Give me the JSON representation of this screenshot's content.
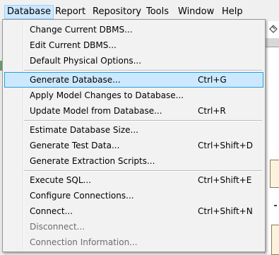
{
  "menubar": {
    "items": [
      "Database",
      "Report",
      "Repository",
      "Tools",
      "Window",
      "Help"
    ],
    "active": "Database"
  },
  "menu": {
    "groups": [
      [
        {
          "label": "Change Current DBMS...",
          "shortcut": "",
          "enabled": true
        },
        {
          "label": "Edit Current DBMS...",
          "shortcut": "",
          "enabled": true
        },
        {
          "label": "Default Physical Options...",
          "shortcut": "",
          "enabled": true
        }
      ],
      [
        {
          "label": "Generate Database...",
          "shortcut": "Ctrl+G",
          "enabled": true,
          "highlighted": true
        },
        {
          "label": "Apply Model Changes to Database...",
          "shortcut": "",
          "enabled": true
        },
        {
          "label": "Update Model from Database...",
          "shortcut": "Ctrl+R",
          "enabled": true
        }
      ],
      [
        {
          "label": "Estimate Database Size...",
          "shortcut": "",
          "enabled": true
        },
        {
          "label": "Generate Test Data...",
          "shortcut": "Ctrl+Shift+D",
          "enabled": true
        },
        {
          "label": "Generate Extraction Scripts...",
          "shortcut": "",
          "enabled": true
        }
      ],
      [
        {
          "label": "Execute SQL...",
          "shortcut": "Ctrl+Shift+E",
          "enabled": true
        },
        {
          "label": "Configure Connections...",
          "shortcut": "",
          "enabled": true
        },
        {
          "label": "Connect...",
          "shortcut": "Ctrl+Shift+N",
          "enabled": true
        },
        {
          "label": "Disconnect...",
          "shortcut": "",
          "enabled": false
        },
        {
          "label": "Connection Information...",
          "shortcut": "",
          "enabled": false
        }
      ]
    ]
  },
  "colors": {
    "highlight_bg": "#cce8ff",
    "highlight_border": "#26a0da",
    "disabled_text": "#6d6d6d"
  }
}
